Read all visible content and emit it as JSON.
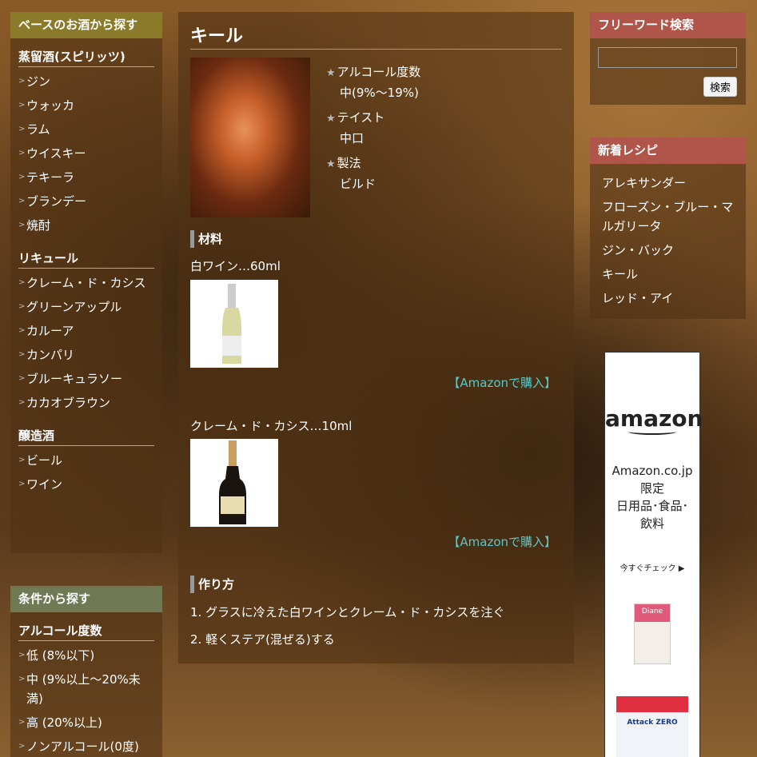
{
  "left": {
    "base": {
      "title": "ベースのお酒から探す",
      "header_color": "#8a7a2a",
      "groups": [
        {
          "title": "蒸留酒(スピリッツ)",
          "items": [
            "ジン",
            "ウォッカ",
            "ラム",
            "ウイスキー",
            "テキーラ",
            "ブランデー",
            "焼酎"
          ]
        },
        {
          "title": "リキュール",
          "items": [
            "クレーム・ド・カシス",
            "グリーンアップル",
            "カルーア",
            "カンパリ",
            "ブルーキュラソー",
            "カカオブラウン"
          ]
        },
        {
          "title": "醸造酒",
          "items": [
            "ビール",
            "ワイン"
          ]
        }
      ]
    },
    "cond": {
      "title": "条件から探す",
      "header_color": "#6f7a55",
      "groups": [
        {
          "title": "アルコール度数",
          "items": [
            "低 (8%以下)",
            "中 (9%以上～20%未満)",
            "高 (20%以上)",
            "ノンアルコール(0度)"
          ]
        }
      ]
    }
  },
  "main": {
    "title": "キール",
    "props": [
      {
        "label": "アルコール度数",
        "value": "中(9%～19%)"
      },
      {
        "label": "テイスト",
        "value": "中口"
      },
      {
        "label": "製法",
        "value": "ビルド"
      }
    ],
    "ingredients_title": "材料",
    "ingredients": [
      {
        "text": "白ワイン…60ml",
        "buy": "【Amazonで購入】"
      },
      {
        "text": "クレーム・ド・カシス…10ml",
        "buy": "【Amazonで購入】"
      }
    ],
    "method_title": "作り方",
    "steps": [
      "1. グラスに冷えた白ワインとクレーム・ド・カシスを注ぐ",
      "2. 軽くステア(混ぜる)する"
    ],
    "link_color": "#5bc8c8"
  },
  "right": {
    "search": {
      "title": "フリーワード検索",
      "value": "",
      "button": "検索",
      "header_color": "#b0554a"
    },
    "recent": {
      "title": "新着レシピ",
      "items": [
        "アレキサンダー",
        "フローズン・ブルー・マルガリータ",
        "ジン・バック",
        "キール",
        "レッド・アイ"
      ]
    },
    "ad": {
      "logo": "amazon",
      "line1": "Amazon.co.jp",
      "line2": "限定",
      "line3": "日用品･食品･",
      "line4": "飲料",
      "cta": "今すぐチェック ▶",
      "product1": "Diane",
      "product2": "Attack ZERO"
    }
  }
}
